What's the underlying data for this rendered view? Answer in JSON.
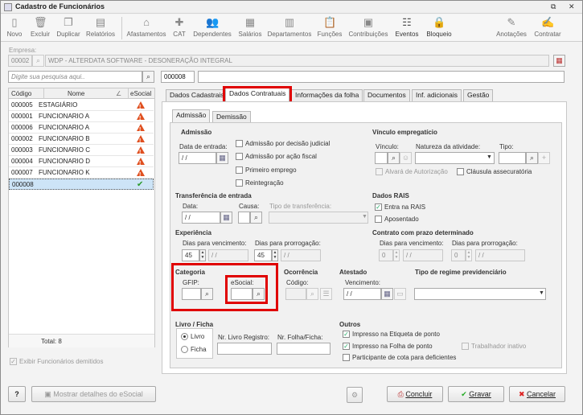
{
  "window": {
    "title": "Cadastro de Funcionários"
  },
  "toolbar": {
    "novo": "Novo",
    "excluir": "Excluir",
    "duplicar": "Duplicar",
    "relatorios": "Relatórios",
    "afastamentos": "Afastamentos",
    "cat": "CAT",
    "dependentes": "Dependentes",
    "salarios": "Salários",
    "departamentos": "Departamentos",
    "funcoes": "Funções",
    "contribuicoes": "Contribuições",
    "eventos": "Eventos",
    "bloqueio": "Bloqueio",
    "anotacoes": "Anotações",
    "contratar": "Contratar"
  },
  "empresa": {
    "label": "Empresa:",
    "code": "00002",
    "name": "WDP - ALTERDATA SOFTWARE - DESONERAÇÃO INTEGRAL"
  },
  "search": {
    "placeholder": "Digite sua pesquisa aqui..",
    "code": "000008"
  },
  "grid": {
    "headers": {
      "codigo": "Código",
      "nome": "Nome",
      "esocial": "eSocial"
    },
    "rows": [
      {
        "code": "000005",
        "name": "ESTAGIÁRIO",
        "status": "warning"
      },
      {
        "code": "000001",
        "name": "FUNCIONARIO A",
        "status": "warning"
      },
      {
        "code": "000006",
        "name": "FUNCIONARIO A",
        "status": "warning"
      },
      {
        "code": "000002",
        "name": "FUNCIONARIO B",
        "status": "warning"
      },
      {
        "code": "000003",
        "name": "FUNCIONARIO C",
        "status": "warning"
      },
      {
        "code": "000004",
        "name": "FUNCIONARIO D",
        "status": "warning"
      },
      {
        "code": "000007",
        "name": "FUNCIONARIO K",
        "status": "warning"
      },
      {
        "code": "000008",
        "name": "",
        "status": "ok"
      }
    ],
    "total": "Total: 8"
  },
  "exibir_demitidos": "Exibir Funcionários demitidos",
  "tabs": {
    "dados_cadastrais": "Dados Cadastrais",
    "dados_contratuais": "Dados Contratuais",
    "info_folha": "Informações da folha",
    "documentos": "Documentos",
    "inf_adicionais": "Inf. adicionais",
    "gestao": "Gestão"
  },
  "subtabs": {
    "admissao": "Admissão",
    "demissao": "Demissão"
  },
  "admissao": {
    "title": "Admissão",
    "data_label": "Data de entrada:",
    "data_value": "/ /",
    "opt_judicial": "Admissão por decisão judicial",
    "opt_fiscal": "Admissão por ação fiscal",
    "opt_primeiro": "Primeiro emprego",
    "opt_reintegracao": "Reintegração"
  },
  "vinculo": {
    "title": "Vínculo empregatício",
    "vinculo_label": "Vínculo:",
    "natureza_label": "Natureza da atividade:",
    "tipo_label": "Tipo:",
    "alvara": "Alvará de Autorização",
    "clausula": "Cláusula assecuratória"
  },
  "transferencia": {
    "title": "Transferência de entrada",
    "data_label": "Data:",
    "data_value": "/ /",
    "causa_label": "Causa:",
    "tipo_label": "Tipo de transferência:"
  },
  "dados_rais": {
    "title": "Dados RAIS",
    "entra": "Entra na RAIS",
    "aposentado": "Aposentado"
  },
  "experiencia": {
    "title": "Experiência",
    "venc_label": "Dias para vencimento:",
    "prorr_label": "Dias para prorrogação:",
    "venc_days": "45",
    "prorr_days": "45",
    "date_value": "/ /"
  },
  "prazo": {
    "title": "Contrato com prazo determinado",
    "venc_label": "Dias para vencimento:",
    "prorr_label": "Dias para prorrogação:",
    "venc_days": "0",
    "prorr_days": "0",
    "date_value": "/ /"
  },
  "categoria": {
    "title": "Categoria",
    "gfip_label": "GFIP:",
    "esocial_label": "eSocial:"
  },
  "ocorrencia": {
    "title": "Ocorrência",
    "codigo_label": "Código:"
  },
  "atestado": {
    "title": "Atestado",
    "venc_label": "Vencimento:",
    "venc_value": "/ /"
  },
  "regime": {
    "title": "Tipo de regime previdenciário"
  },
  "livro": {
    "title": "Livro / Ficha",
    "opt_livro": "Livro",
    "opt_ficha": "Ficha",
    "nr_livro_label": "Nr. Livro Registro:",
    "nr_folha_label": "Nr. Folha/Ficha:"
  },
  "outros": {
    "title": "Outros",
    "etiqueta": "Impresso na Etiqueta de ponto",
    "folha_ponto": "Impresso na Folha de ponto",
    "trab_inativo": "Trabalhador inativo",
    "cota": "Participante de cota para deficientes"
  },
  "footer": {
    "help": "?",
    "mostrar": "Mostrar detalhes do eSocial",
    "concluir": "Concluir",
    "gravar": "Gravar",
    "cancelar": "Cancelar"
  }
}
